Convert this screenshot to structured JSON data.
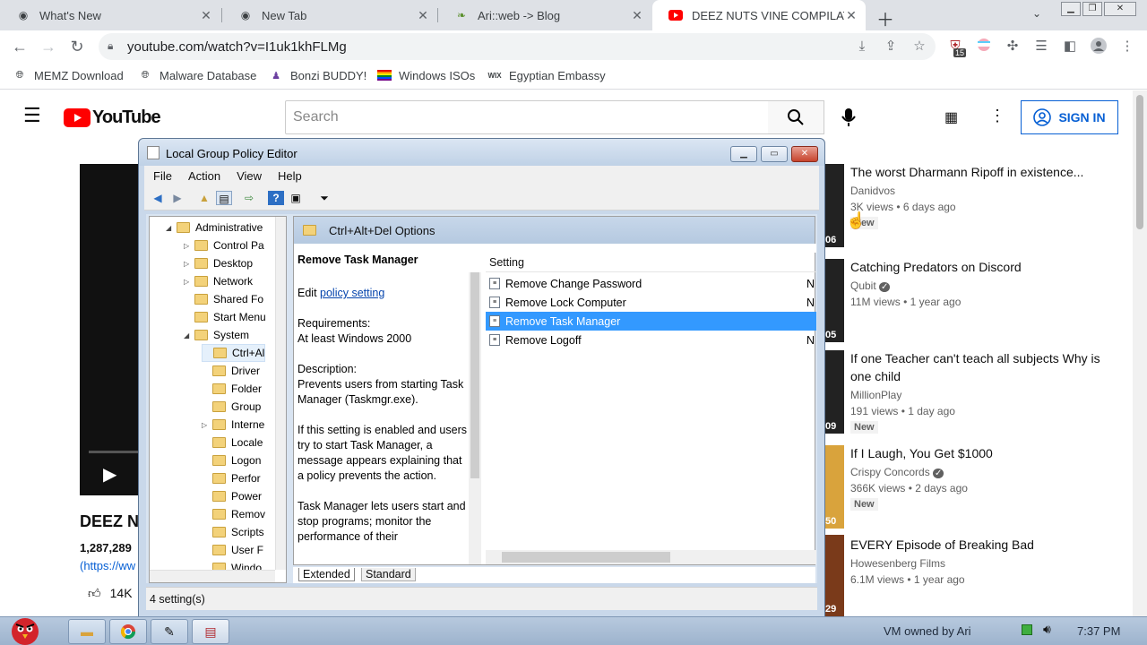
{
  "browser": {
    "tabs": [
      {
        "title": "What's New"
      },
      {
        "title": "New Tab"
      },
      {
        "title": "Ari::web -> Blog"
      },
      {
        "title": "DEEZ NUTS VINE COMPILATIO"
      }
    ],
    "url": "youtube.com/watch?v=I1uk1khFLMg",
    "extension_badge": "15",
    "bookmarks": [
      {
        "label": "MEMZ Download"
      },
      {
        "label": "Malware Database"
      },
      {
        "label": "Bonzi BUDDY!"
      },
      {
        "label": "Windows ISOs"
      },
      {
        "label": "Egyptian Embassy"
      }
    ]
  },
  "youtube": {
    "logo": "YouTube",
    "search_placeholder": "Search",
    "signin": "SIGN IN",
    "video_title": "DEEZ N",
    "views": "1,287,289",
    "link_fragment": "(https://ww",
    "likes": "14K",
    "recommended": [
      {
        "title": "The worst Dharmann Ripoff in existence...",
        "channel": "Danidvos",
        "meta": "3K views • 6 days ago",
        "badge": "New",
        "duration": "06"
      },
      {
        "title": "Catching Predators on Discord",
        "channel": "Qubit",
        "meta": "11M views • 1 year ago",
        "badge": "",
        "duration": "05"
      },
      {
        "title": "If one Teacher can't teach all subjects Why is one child",
        "channel": "MillionPlay",
        "meta": "191 views • 1 day ago",
        "badge": "New",
        "duration": "09"
      },
      {
        "title": "If I Laugh, You Get $1000",
        "channel": "Crispy Concords",
        "meta": "366K views • 2 days ago",
        "badge": "New",
        "duration": "50"
      },
      {
        "title": "EVERY Episode of Breaking Bad",
        "channel": "Howesenberg Films",
        "meta": "6.1M views • 1 year ago",
        "badge": "",
        "duration": "29"
      }
    ]
  },
  "gpe": {
    "title": "Local Group Policy Editor",
    "menu": [
      "File",
      "Action",
      "View",
      "Help"
    ],
    "tree": [
      {
        "label": "Administrative",
        "level": 0,
        "expander": "◢"
      },
      {
        "label": "Control Pa",
        "level": 1,
        "expander": "▷"
      },
      {
        "label": "Desktop",
        "level": 1,
        "expander": "▷"
      },
      {
        "label": "Network",
        "level": 1,
        "expander": "▷"
      },
      {
        "label": "Shared Fo",
        "level": 1,
        "expander": ""
      },
      {
        "label": "Start Menu",
        "level": 1,
        "expander": ""
      },
      {
        "label": "System",
        "level": 1,
        "expander": "◢"
      },
      {
        "label": "Ctrl+Al",
        "level": 2,
        "expander": ""
      },
      {
        "label": "Driver",
        "level": 2,
        "expander": ""
      },
      {
        "label": "Folder",
        "level": 2,
        "expander": ""
      },
      {
        "label": "Group",
        "level": 2,
        "expander": ""
      },
      {
        "label": "Interne",
        "level": 2,
        "expander": "▷"
      },
      {
        "label": "Locale",
        "level": 2,
        "expander": ""
      },
      {
        "label": "Logon",
        "level": 2,
        "expander": ""
      },
      {
        "label": "Perfor",
        "level": 2,
        "expander": ""
      },
      {
        "label": "Power",
        "level": 2,
        "expander": ""
      },
      {
        "label": "Remov",
        "level": 2,
        "expander": ""
      },
      {
        "label": "Scripts",
        "level": 2,
        "expander": ""
      },
      {
        "label": "User F",
        "level": 2,
        "expander": ""
      },
      {
        "label": "Windo",
        "level": 2,
        "expander": ""
      }
    ],
    "pane_title": "Ctrl+Alt+Del Options",
    "desc": {
      "heading": "Remove Task Manager",
      "edit_prefix": "Edit",
      "edit_link": "policy setting",
      "req_label": "Requirements:",
      "req_value": "At least Windows 2000",
      "desc_label": "Description:",
      "desc_value": "Prevents users from starting Task Manager (Taskmgr.exe).",
      "para1": "If this setting is enabled and users try to start Task Manager, a message appears explaining that a policy prevents the action.",
      "para2": "Task Manager lets users start and stop programs; monitor the performance of their"
    },
    "settings_header": "Setting",
    "settings": [
      {
        "name": "Remove Change Password",
        "state": "N"
      },
      {
        "name": "Remove Lock Computer",
        "state": "N"
      },
      {
        "name": "Remove Task Manager",
        "state": ""
      },
      {
        "name": "Remove Logoff",
        "state": "N"
      }
    ],
    "tabs": [
      "Extended",
      "Standard"
    ],
    "status": "4 setting(s)"
  },
  "taskbar": {
    "tray_text": "VM owned by Ari",
    "clock": "7:37 PM"
  }
}
